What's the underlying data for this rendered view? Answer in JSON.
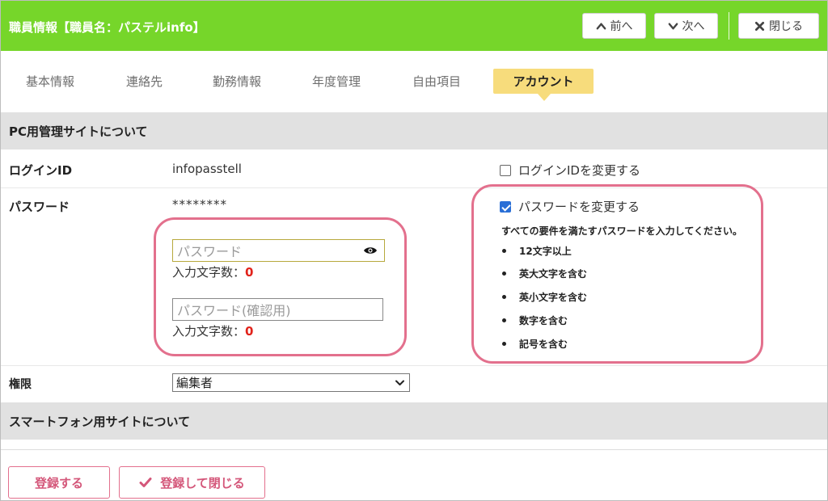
{
  "header": {
    "title": "職員情報【職員名：パステルinfo】",
    "prev_label": "前へ",
    "next_label": "次へ",
    "close_label": "閉じる"
  },
  "tabs": [
    {
      "label": "基本情報"
    },
    {
      "label": "連絡先"
    },
    {
      "label": "勤務情報"
    },
    {
      "label": "年度管理"
    },
    {
      "label": "自由項目"
    },
    {
      "label": "アカウント"
    }
  ],
  "pc_section": {
    "title": "PC用管理サイトについて",
    "login_id": {
      "label": "ログインID",
      "value": "infopasstell",
      "change_label": "ログインIDを変更する",
      "change_checked": false
    },
    "password": {
      "label": "パスワード",
      "masked_value": "********",
      "input_placeholder": "パスワード",
      "confirm_placeholder": "パスワード(確認用)",
      "count_label": "入力文字数：",
      "count_value": "0",
      "confirm_count_label": "入力文字数：",
      "confirm_count_value": "0",
      "change_label": "パスワードを変更する",
      "change_checked": true,
      "requirements_title": "すべての要件を満たすパスワードを入力してください。",
      "requirements": [
        "12文字以上",
        "英大文字を含む",
        "英小文字を含む",
        "数字を含む",
        "記号を含む"
      ]
    },
    "role": {
      "label": "権限",
      "selected": "編集者"
    }
  },
  "sp_section": {
    "title": "スマートフォン用サイトについて"
  },
  "footer": {
    "register_label": "登録する",
    "register_close_label": "登録して閉じる"
  },
  "colors": {
    "header_green": "#76d62a",
    "active_tab": "#f7dc7c",
    "highlight_pink": "#e3708d",
    "count_red": "#e1231b",
    "checkbox_blue": "#2a6fd6",
    "band_gray": "#e1e1e1"
  },
  "icons": [
    "chevron-up-icon",
    "chevron-down-icon",
    "close-x-icon",
    "eye-icon",
    "checkmark-icon",
    "select-arrow-icon"
  ]
}
